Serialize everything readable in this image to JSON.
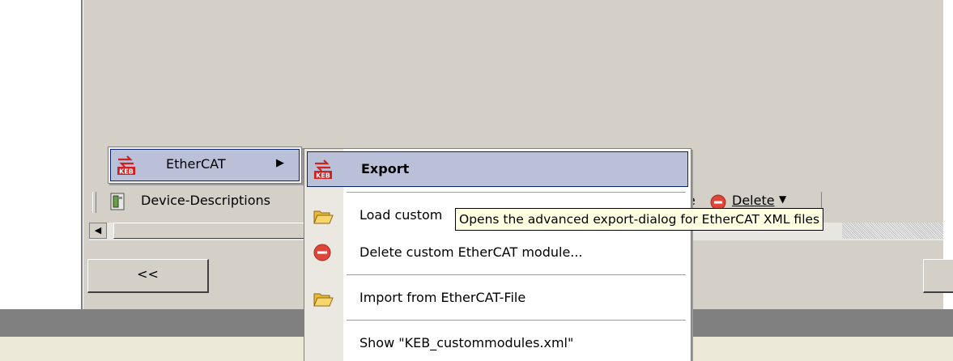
{
  "toolbar": {
    "device_descriptions_label": "Device-Descriptions",
    "delete_label": "Delete",
    "partial_text": "e"
  },
  "nav": {
    "back_label": "<<"
  },
  "parent_menu": {
    "ethercat_label": "EtherCAT"
  },
  "submenu": {
    "items": [
      {
        "label": "Export",
        "icon": "keb-export-icon"
      },
      {
        "label": "Load custom",
        "icon": "folder-open-icon"
      },
      {
        "label": "Delete custom EtherCAT module...",
        "icon": "delete-icon"
      },
      {
        "label": "Import from EtherCAT-File",
        "icon": "folder-open-icon"
      },
      {
        "label": "Show \"KEB_custommodules.xml\""
      }
    ]
  },
  "tooltip": {
    "text": "Opens the advanced export-dialog for EtherCAT XML files"
  },
  "colors": {
    "window_bg": "#d4d0c8",
    "highlight": "#b9c0d8",
    "highlight_border": "#0a246a",
    "tooltip_bg": "#ffffe1",
    "delete_red": "#e0453b"
  }
}
